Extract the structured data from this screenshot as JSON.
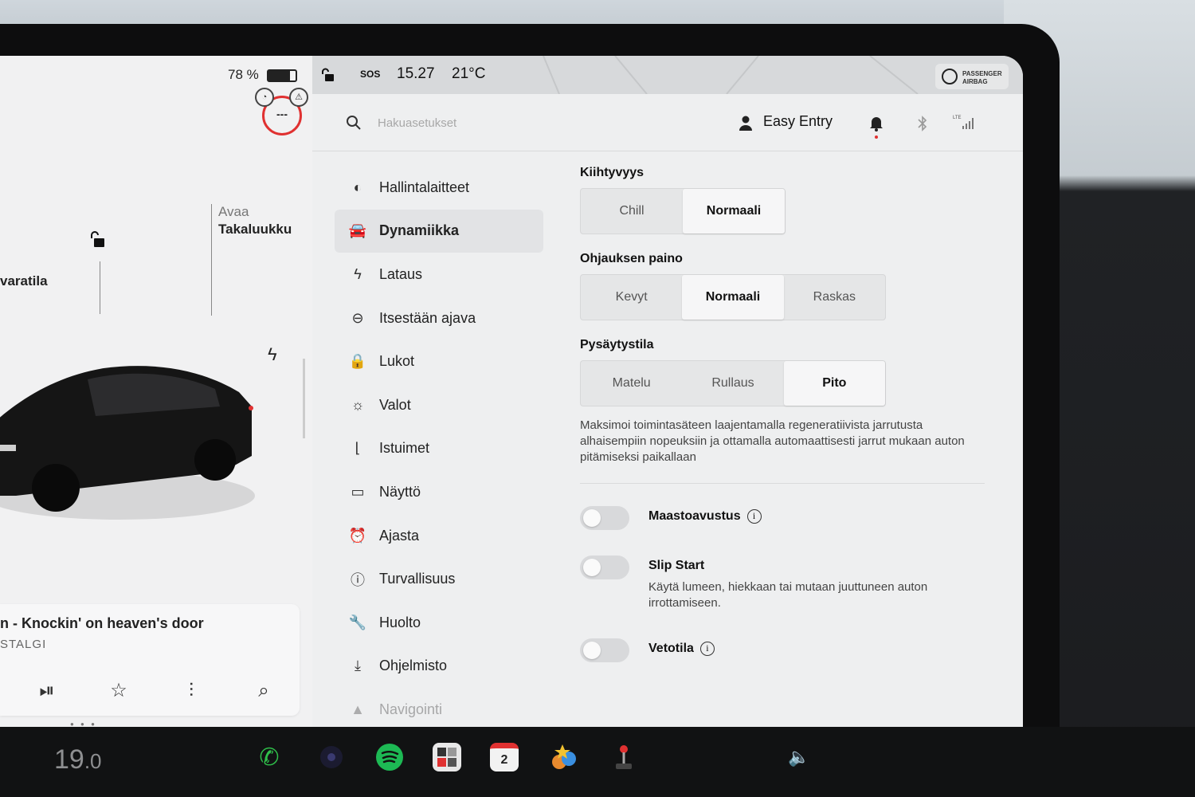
{
  "status": {
    "battery_percent": "78 %",
    "battery_level": 0.78,
    "sos": "SOS",
    "time": "15.27",
    "temperature": "21°C",
    "airbag_line1": "PASSENGER",
    "airbag_line2": "AIRBAG"
  },
  "adas": {
    "speed_display": "---"
  },
  "vehicle": {
    "trunk_action": "Avaa",
    "trunk_label": "Takaluukku",
    "front_label": "varatila"
  },
  "media": {
    "song": "n - Knockin' on heaven's door",
    "artist": "STALGI"
  },
  "search": {
    "placeholder": "Hakuasetukset"
  },
  "profile": {
    "name": "Easy Entry"
  },
  "nav": {
    "items": [
      {
        "label": "Hallintalaitteet",
        "icon": "toggle-icon"
      },
      {
        "label": "Dynamiikka",
        "icon": "car-icon",
        "active": true
      },
      {
        "label": "Lataus",
        "icon": "bolt-icon"
      },
      {
        "label": "Itsestään ajava",
        "icon": "steering-wheel-icon"
      },
      {
        "label": "Lukot",
        "icon": "lock-icon"
      },
      {
        "label": "Valot",
        "icon": "sun-icon"
      },
      {
        "label": "Istuimet",
        "icon": "seat-icon"
      },
      {
        "label": "Näyttö",
        "icon": "display-icon"
      },
      {
        "label": "Ajasta",
        "icon": "alarm-clock-icon"
      },
      {
        "label": "Turvallisuus",
        "icon": "alert-circle-icon"
      },
      {
        "label": "Huolto",
        "icon": "wrench-icon"
      },
      {
        "label": "Ohjelmisto",
        "icon": "download-icon"
      },
      {
        "label": "Navigointi",
        "icon": "navigation-icon"
      }
    ]
  },
  "dynamics": {
    "acceleration": {
      "title": "Kiihtyvyys",
      "options": [
        "Chill",
        "Normaali"
      ],
      "selected": "Normaali"
    },
    "steering": {
      "title": "Ohjauksen paino",
      "options": [
        "Kevyt",
        "Normaali",
        "Raskas"
      ],
      "selected": "Normaali"
    },
    "stopping": {
      "title": "Pysäytystila",
      "options": [
        "Matelu",
        "Rullaus",
        "Pito"
      ],
      "selected": "Pito",
      "description": "Maksimoi toimintasäteen laajentamalla regeneratiivista jarrutusta alhaisempiin nopeuksiin ja ottamalla automaattisesti jarrut mukaan auton pitämiseksi paikallaan"
    },
    "toggles": [
      {
        "label": "Maastoavustus",
        "on": false,
        "info": true
      },
      {
        "label": "Slip Start",
        "on": false,
        "description": "Käytä lumeen, hiekkaan tai mutaan juuttuneen auton irrottamiseen."
      },
      {
        "label": "Vetotila",
        "on": false,
        "info": true
      }
    ]
  },
  "taskbar": {
    "temperature": "19",
    "temperature_decimal": ".0",
    "calendar_day": "2",
    "colors": {
      "phone": "#2fbf4a",
      "spotify": "#1db954",
      "accent_red": "#e03131"
    }
  }
}
